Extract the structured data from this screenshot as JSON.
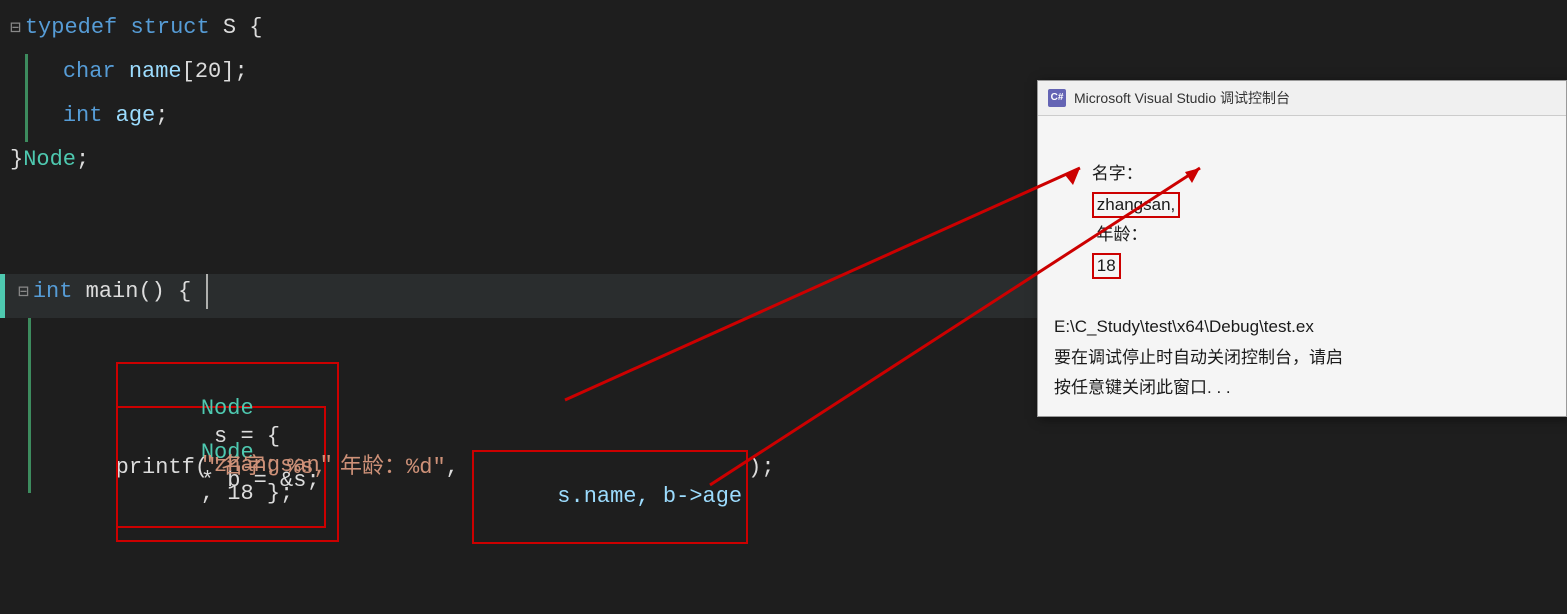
{
  "editor": {
    "background": "#1e1e1e",
    "lines": [
      {
        "id": "line1",
        "collapsible": true,
        "minus": "⊟",
        "parts": [
          {
            "text": "typedef",
            "cls": "kw"
          },
          {
            "text": " ",
            "cls": "plain"
          },
          {
            "text": "struct",
            "cls": "kw"
          },
          {
            "text": " S {",
            "cls": "plain"
          }
        ]
      },
      {
        "id": "line2",
        "indent": "        ",
        "parts": [
          {
            "text": "char",
            "cls": "kw"
          },
          {
            "text": " name[20];",
            "cls": "plain"
          }
        ]
      },
      {
        "id": "line3",
        "indent": "        ",
        "parts": [
          {
            "text": "int",
            "cls": "kw"
          },
          {
            "text": " age;",
            "cls": "plain"
          }
        ]
      },
      {
        "id": "line4",
        "parts": [
          {
            "text": "}",
            "cls": "plain"
          },
          {
            "text": "Node",
            "cls": "type-name"
          },
          {
            "text": ";",
            "cls": "plain"
          }
        ]
      },
      {
        "id": "line5",
        "parts": []
      },
      {
        "id": "line6",
        "parts": []
      },
      {
        "id": "line7",
        "collapsible": true,
        "minus": "⊟",
        "parts": [
          {
            "text": "int",
            "cls": "kw"
          },
          {
            "text": " ",
            "cls": "plain"
          },
          {
            "text": "main",
            "cls": "plain"
          },
          {
            "text": "() {",
            "cls": "plain"
          }
        ],
        "highlighted": true
      },
      {
        "id": "line8",
        "parts": []
      },
      {
        "id": "line9",
        "indent": "        ",
        "parts": [
          {
            "text": "Node",
            "cls": "type-name"
          },
          {
            "text": " s = { ",
            "cls": "plain"
          },
          {
            "text": "\"zhangsan\"",
            "cls": "string"
          },
          {
            "text": ", 18 };",
            "cls": "plain"
          }
        ],
        "boxed": true
      },
      {
        "id": "line10",
        "indent": "        ",
        "parts": [
          {
            "text": "Node",
            "cls": "type-name"
          },
          {
            "text": "* b = &s;",
            "cls": "plain"
          }
        ],
        "boxed": true
      },
      {
        "id": "line11",
        "indent": "        ",
        "parts": [
          {
            "text": "printf(",
            "cls": "plain"
          },
          {
            "text": "\"名字：%s, 年龄：%d\"",
            "cls": "string"
          },
          {
            "text": ", ",
            "cls": "plain"
          },
          {
            "text": "s.name, b->age",
            "cls": "plain"
          },
          {
            "text": ");",
            "cls": "plain"
          }
        ],
        "boxed_part": "s.name, b->age"
      }
    ]
  },
  "console": {
    "title": "Microsoft Visual Studio 调试控制台",
    "icon_letter": "C#",
    "output_line1_prefix": "名字：",
    "output_line1_name_highlighted": "zhangsan,",
    "output_line1_age_label": " 年龄：",
    "output_line1_age_highlighted": "18",
    "output_line2": "E:\\C_Study\\test\\x64\\Debug\\test.ex",
    "output_line3": "要在调试停止时自动关闭控制台，请启",
    "output_line4": "按任意键关闭此窗口. . ."
  }
}
